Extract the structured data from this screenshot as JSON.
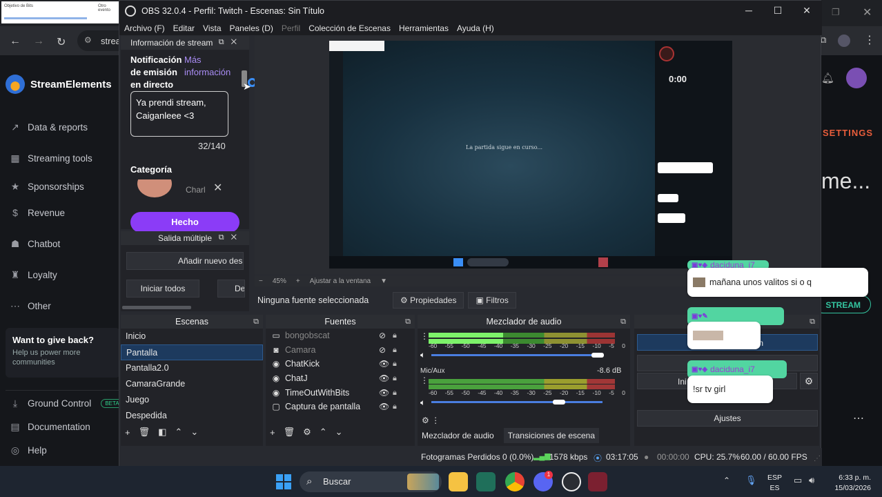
{
  "browser": {
    "tab_snippet_1": "Objetivo de Bits",
    "tab_snippet_2": "Otro evento",
    "url_prefix": "strea",
    "brand": "StreamElements",
    "nav": [
      {
        "label": "Data & reports",
        "icon": "bar-chart-icon"
      },
      {
        "label": "Streaming tools",
        "icon": "layers-icon"
      },
      {
        "label": "Sponsorships",
        "icon": "star-icon"
      },
      {
        "label": "Revenue",
        "icon": "dollar-icon"
      },
      {
        "label": "Chatbot",
        "icon": "robot-icon"
      },
      {
        "label": "Loyalty",
        "icon": "loyalty-icon"
      },
      {
        "label": "Other",
        "icon": "more-icon"
      }
    ],
    "give_back_title": "Want to give back?",
    "give_back_sub": "Help us power more communities",
    "bottom_nav": [
      {
        "label": "Ground Control",
        "badge": "BETA"
      },
      {
        "label": "Documentation"
      },
      {
        "label": "Help"
      }
    ],
    "right_settings": "SETTINGS",
    "right_heading": "me...",
    "right_stream_btn": "STREAM"
  },
  "obs": {
    "title": "OBS 32.0.4 - Perfil: Twitch - Escenas: Sin Título",
    "menu": [
      "Archivo (F)",
      "Editar",
      "Vista",
      "Paneles (D)",
      "Perfil",
      "Colección de Escenas",
      "Herramientas",
      "Ayuda (H)"
    ],
    "stream_info": {
      "dock_title": "Información de stream",
      "notif_label": "Notificación de emisión en directo",
      "more_info": "Más información",
      "text_value": "Ya prendi stream, Caiganleee <3",
      "char_count": "32/140",
      "category_label": "Categoría",
      "category_value": "Charl",
      "done_button": "Hecho"
    },
    "multi_output": {
      "dock_title": "Salida múltiple",
      "add_new": "Añadir nuevo des",
      "start_all": "Iniciar todos",
      "stop_all": "De"
    },
    "preview": {
      "screen_message": "La partida sigue en curso...",
      "zoom": "45%",
      "fit": "Ajustar a la ventana"
    },
    "source_bar": {
      "none_selected": "Ninguna fuente seleccionada",
      "properties": "Propiedades",
      "filters": "Filtros"
    },
    "scenes": {
      "title": "Escenas",
      "items": [
        "Inicio",
        "Pantalla",
        "Pantalla2.0",
        "CamaraGrande",
        "Juego",
        "Despedida"
      ],
      "selected": "Pantalla"
    },
    "sources": {
      "title": "Fuentes",
      "items": [
        {
          "name": "bongobscat",
          "icon": "image-icon",
          "visible": false
        },
        {
          "name": "Camara",
          "icon": "camera-icon",
          "visible": false
        },
        {
          "name": "ChatKick",
          "icon": "browser-icon",
          "visible": true
        },
        {
          "name": "ChatJ",
          "icon": "browser-icon",
          "visible": true
        },
        {
          "name": "TimeOutWithBits",
          "icon": "browser-icon",
          "visible": true
        },
        {
          "name": "Captura de pantalla",
          "icon": "monitor-icon",
          "visible": true
        }
      ]
    },
    "mixer": {
      "title": "Mezclador de audio",
      "scale": [
        "-60",
        "-55",
        "-50",
        "-45",
        "-40",
        "-35",
        "-30",
        "-25",
        "-20",
        "-15",
        "-10",
        "-5",
        "0"
      ],
      "channel2_name": "Mic/Aux",
      "channel2_db": "-8.6 dB",
      "tab_mixer": "Mezclador de audio",
      "tab_transitions": "Transiciones de escena"
    },
    "controls": {
      "settings": "Ajustes",
      "partial_1": "n",
      "partial_2": "Ini"
    },
    "status": {
      "frames_dropped": "Fotogramas Perdidos 0 (0.0%)",
      "bitrate": "1578 kbps",
      "stream_time": "03:17:05",
      "rec_time": "00:00:00",
      "cpu": "CPU: 25.7%",
      "fps": "60.00 / 60.00 FPS"
    }
  },
  "chat_overlay": [
    {
      "user": "daciduna_i7",
      "message": "mañana unos valitos si o q"
    },
    {
      "user": "",
      "message": ""
    },
    {
      "user": "daciduna_i7",
      "message": "!sr tv girl"
    }
  ],
  "taskbar": {
    "search": "Buscar",
    "lang_top": "ESP",
    "lang_bottom": "ES",
    "time": "6:33 p. m.",
    "date": "15/03/2026",
    "discord_badge": "1"
  },
  "colors": {
    "obs_bg": "#282a30",
    "accent_purple": "#8b3cf7",
    "se_orange": "#e85d3b",
    "chat_green": "#52d5a1"
  }
}
